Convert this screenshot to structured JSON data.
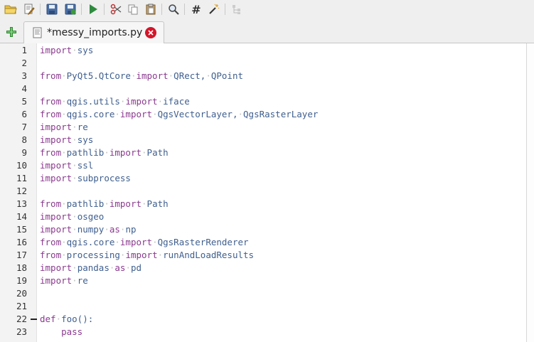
{
  "toolbar": {
    "buttons": [
      "open-folder-icon",
      "edit-script-icon",
      "save-icon",
      "save-as-icon",
      "run-icon",
      "cut-icon",
      "copy-icon",
      "paste-icon",
      "find-icon",
      "comment-icon",
      "format-icon",
      "tree-icon"
    ]
  },
  "tabs": {
    "active": {
      "title": "*messy_imports.py"
    }
  },
  "editor": {
    "lines": [
      {
        "n": "1",
        "tokens": [
          [
            "kw",
            "import"
          ],
          [
            "dot",
            "·"
          ],
          [
            "id",
            "sys"
          ]
        ]
      },
      {
        "n": "2",
        "tokens": []
      },
      {
        "n": "3",
        "tokens": [
          [
            "kw",
            "from"
          ],
          [
            "dot",
            "·"
          ],
          [
            "id",
            "PyQt5.QtCore"
          ],
          [
            "dot",
            "·"
          ],
          [
            "kw",
            "import"
          ],
          [
            "dot",
            "·"
          ],
          [
            "id",
            "QRect,"
          ],
          [
            "dot",
            "·"
          ],
          [
            "id",
            "QPoint"
          ]
        ]
      },
      {
        "n": "4",
        "tokens": []
      },
      {
        "n": "5",
        "tokens": [
          [
            "kw",
            "from"
          ],
          [
            "dot",
            "·"
          ],
          [
            "id",
            "qgis.utils"
          ],
          [
            "dot",
            "·"
          ],
          [
            "kw",
            "import"
          ],
          [
            "dot",
            "·"
          ],
          [
            "id",
            "iface"
          ]
        ]
      },
      {
        "n": "6",
        "tokens": [
          [
            "kw",
            "from"
          ],
          [
            "dot",
            "·"
          ],
          [
            "id",
            "qgis.core"
          ],
          [
            "dot",
            "·"
          ],
          [
            "kw",
            "import"
          ],
          [
            "dot",
            "·"
          ],
          [
            "id",
            "QgsVectorLayer,"
          ],
          [
            "dot",
            "·"
          ],
          [
            "id",
            "QgsRasterLayer"
          ]
        ]
      },
      {
        "n": "7",
        "tokens": [
          [
            "kw",
            "import"
          ],
          [
            "dot",
            "·"
          ],
          [
            "id",
            "re"
          ]
        ]
      },
      {
        "n": "8",
        "tokens": [
          [
            "kw",
            "import"
          ],
          [
            "dot",
            "·"
          ],
          [
            "id",
            "sys"
          ]
        ]
      },
      {
        "n": "9",
        "tokens": [
          [
            "kw",
            "from"
          ],
          [
            "dot",
            "·"
          ],
          [
            "id",
            "pathlib"
          ],
          [
            "dot",
            "·"
          ],
          [
            "kw",
            "import"
          ],
          [
            "dot",
            "·"
          ],
          [
            "id",
            "Path"
          ]
        ]
      },
      {
        "n": "10",
        "tokens": [
          [
            "kw",
            "import"
          ],
          [
            "dot",
            "·"
          ],
          [
            "id",
            "ssl"
          ]
        ]
      },
      {
        "n": "11",
        "tokens": [
          [
            "kw",
            "import"
          ],
          [
            "dot",
            "·"
          ],
          [
            "id",
            "subprocess"
          ]
        ]
      },
      {
        "n": "12",
        "tokens": []
      },
      {
        "n": "13",
        "tokens": [
          [
            "kw",
            "from"
          ],
          [
            "dot",
            "·"
          ],
          [
            "id",
            "pathlib"
          ],
          [
            "dot",
            "·"
          ],
          [
            "kw",
            "import"
          ],
          [
            "dot",
            "·"
          ],
          [
            "id",
            "Path"
          ]
        ]
      },
      {
        "n": "14",
        "tokens": [
          [
            "kw",
            "import"
          ],
          [
            "dot",
            "·"
          ],
          [
            "id",
            "osgeo"
          ]
        ]
      },
      {
        "n": "15",
        "tokens": [
          [
            "kw",
            "import"
          ],
          [
            "dot",
            "·"
          ],
          [
            "id",
            "numpy"
          ],
          [
            "dot",
            "·"
          ],
          [
            "kw",
            "as"
          ],
          [
            "dot",
            "·"
          ],
          [
            "id",
            "np"
          ]
        ]
      },
      {
        "n": "16",
        "tokens": [
          [
            "kw",
            "from"
          ],
          [
            "dot",
            "·"
          ],
          [
            "id",
            "qgis.core"
          ],
          [
            "dot",
            "·"
          ],
          [
            "kw",
            "import"
          ],
          [
            "dot",
            "·"
          ],
          [
            "id",
            "QgsRasterRenderer"
          ]
        ]
      },
      {
        "n": "17",
        "tokens": [
          [
            "kw",
            "from"
          ],
          [
            "dot",
            "·"
          ],
          [
            "id",
            "processing"
          ],
          [
            "dot",
            "·"
          ],
          [
            "kw",
            "import"
          ],
          [
            "dot",
            "·"
          ],
          [
            "id",
            "runAndLoadResults"
          ]
        ]
      },
      {
        "n": "18",
        "tokens": [
          [
            "kw",
            "import"
          ],
          [
            "dot",
            "·"
          ],
          [
            "id",
            "pandas"
          ],
          [
            "dot",
            "·"
          ],
          [
            "kw",
            "as"
          ],
          [
            "dot",
            "·"
          ],
          [
            "id",
            "pd"
          ]
        ]
      },
      {
        "n": "19",
        "tokens": [
          [
            "kw",
            "import"
          ],
          [
            "dot",
            "·"
          ],
          [
            "id",
            "re"
          ]
        ]
      },
      {
        "n": "20",
        "tokens": []
      },
      {
        "n": "21",
        "tokens": []
      },
      {
        "n": "22",
        "tokens": [
          [
            "kw",
            "def"
          ],
          [
            "dot",
            "·"
          ],
          [
            "id",
            "foo():"
          ]
        ],
        "fold": true
      },
      {
        "n": "23",
        "tokens": [
          [
            "id",
            "    "
          ],
          [
            "kw",
            "pass"
          ]
        ]
      }
    ]
  },
  "colors": {
    "keyword": "#8b3a8f",
    "identifier": "#3f5f8f",
    "whitespace_dot": "#c0c0c0",
    "close_badge": "#d4152a"
  }
}
